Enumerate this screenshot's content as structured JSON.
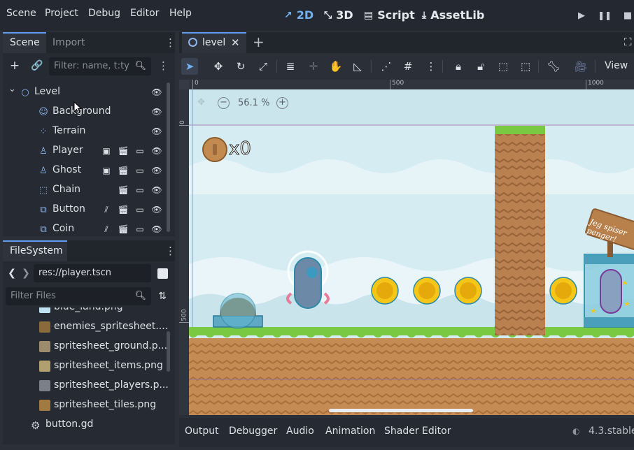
{
  "menubar": {
    "menus": [
      "Scene",
      "Project",
      "Debug",
      "Editor",
      "Help"
    ],
    "workspaces": [
      {
        "label": "2D",
        "icon": "2d-icon",
        "active": true
      },
      {
        "label": "3D",
        "icon": "3d-icon",
        "active": false
      },
      {
        "label": "Script",
        "icon": "script-icon",
        "active": false
      },
      {
        "label": "AssetLib",
        "icon": "assetlib-icon",
        "active": false
      }
    ],
    "play_controls": [
      "play-icon",
      "pause-icon",
      "stop-icon"
    ]
  },
  "scene_dock": {
    "tabs": [
      "Scene",
      "Import"
    ],
    "active_tab": "Scene",
    "filter_placeholder": "Filter: name, t:ty",
    "tree": [
      {
        "label": "Level",
        "icon": "node2d-icon",
        "depth": 0,
        "expanded": true,
        "badges": [
          "visibility-icon"
        ]
      },
      {
        "label": "Background",
        "icon": "parallax-icon",
        "depth": 1,
        "badges": [
          "visibility-icon"
        ]
      },
      {
        "label": "Terrain",
        "icon": "tilemap-icon",
        "depth": 1,
        "badges": [
          "visibility-icon"
        ]
      },
      {
        "label": "Player",
        "icon": "character-body-icon",
        "depth": 1,
        "badges": [
          "instance-icon",
          "clapper-icon",
          "script-icon",
          "visibility-icon"
        ]
      },
      {
        "label": "Ghost",
        "icon": "character-body-icon",
        "depth": 1,
        "badges": [
          "instance-icon",
          "clapper-icon",
          "script-icon",
          "visibility-icon"
        ]
      },
      {
        "label": "Chain",
        "icon": "node2d-box-icon",
        "depth": 1,
        "badges": [
          "clapper-icon",
          "script-icon",
          "visibility-icon"
        ]
      },
      {
        "label": "Button",
        "icon": "area2d-icon",
        "depth": 1,
        "badges": [
          "signal-icon",
          "clapper-icon",
          "script-icon",
          "visibility-icon"
        ]
      },
      {
        "label": "Coin",
        "icon": "area2d-icon",
        "depth": 1,
        "badges": [
          "signal-icon",
          "clapper-icon",
          "script-icon",
          "visibility-icon"
        ]
      }
    ]
  },
  "filesystem_dock": {
    "title": "FileSystem",
    "path": "res://player.tscn",
    "filter_placeholder": "Filter Files",
    "files": [
      {
        "label": "blue_land.png",
        "color": "#bfe3f0"
      },
      {
        "label": "enemies_spritesheet....",
        "color": "#8a6a3a"
      },
      {
        "label": "spritesheet_ground.p...",
        "color": "#9c8c6c"
      },
      {
        "label": "spritesheet_items.png",
        "color": "#b0a070"
      },
      {
        "label": "spritesheet_players.p...",
        "color": "#7a7f88"
      },
      {
        "label": "spritesheet_tiles.png",
        "color": "#a07a40"
      },
      {
        "label": "button.gd",
        "color": "#c8ccd2"
      }
    ]
  },
  "editor": {
    "scene_tab": "level",
    "toolbar_view_label": "View",
    "zoom_label": "56.1 %",
    "ruler_top": [
      "0",
      "500",
      "1000"
    ],
    "ruler_left": [
      "0",
      "500"
    ],
    "coin_counter": "x0",
    "sign_text": "Jeg spiser penger!"
  },
  "bottom_panel": {
    "tabs": [
      "Output",
      "Debugger",
      "Audio",
      "Animation",
      "Shader Editor"
    ],
    "version": "4.3.stable"
  },
  "colors": {
    "accent": "#5d9cec",
    "accent_text": "#72b0f0",
    "sky": "#cfe8ee",
    "grass": "#7ac943",
    "dirt": "#c0894f",
    "coin": "#f5c518"
  }
}
